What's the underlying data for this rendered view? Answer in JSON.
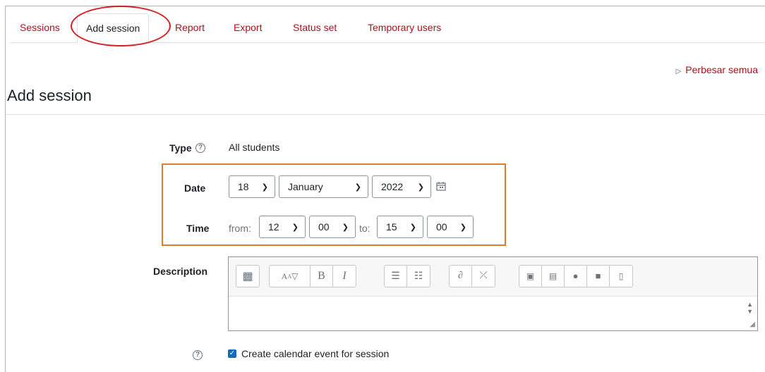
{
  "tabs": [
    {
      "label": "Sessions"
    },
    {
      "label": "Add session"
    },
    {
      "label": "Report"
    },
    {
      "label": "Export"
    },
    {
      "label": "Status set"
    },
    {
      "label": "Temporary users"
    }
  ],
  "expand_all": "Perbesar semua",
  "heading": "Add session",
  "type": {
    "label": "Type",
    "value": "All students"
  },
  "date": {
    "label": "Date",
    "day": "18",
    "month": "January",
    "year": "2022"
  },
  "time": {
    "label": "Time",
    "from_label": "from:",
    "from_hour": "12",
    "from_minute": "00",
    "to_label": "to:",
    "to_hour": "15",
    "to_minute": "00"
  },
  "description": {
    "label": "Description",
    "value": ""
  },
  "calendar_event": {
    "label": "Create calendar event for session",
    "checked": true
  },
  "colors": {
    "accent": "#0f6cbf",
    "link": "#b20e1a",
    "highlight_circle": "#d91c24",
    "highlight_box": "#e07b2a"
  }
}
